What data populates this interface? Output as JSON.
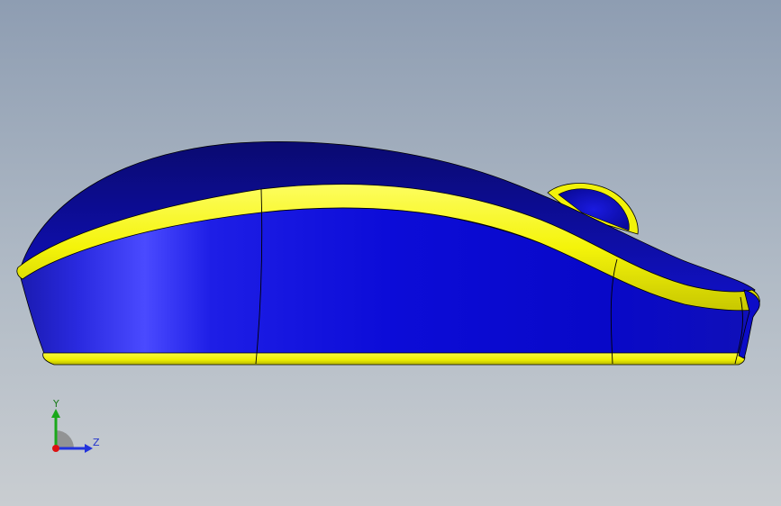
{
  "viewport": {
    "background_top": "#8e9db2",
    "background_bottom": "#c9cdd1"
  },
  "model": {
    "name": "computer-mouse",
    "body_color": "#0a0ad8",
    "trim_color": "#f2f20a",
    "edge_color": "#000000"
  },
  "triad": {
    "y_label": "Y",
    "z_label": "Z",
    "y_color": "#1aa81a",
    "z_color": "#2233dd",
    "x_color": "#dd1111"
  }
}
